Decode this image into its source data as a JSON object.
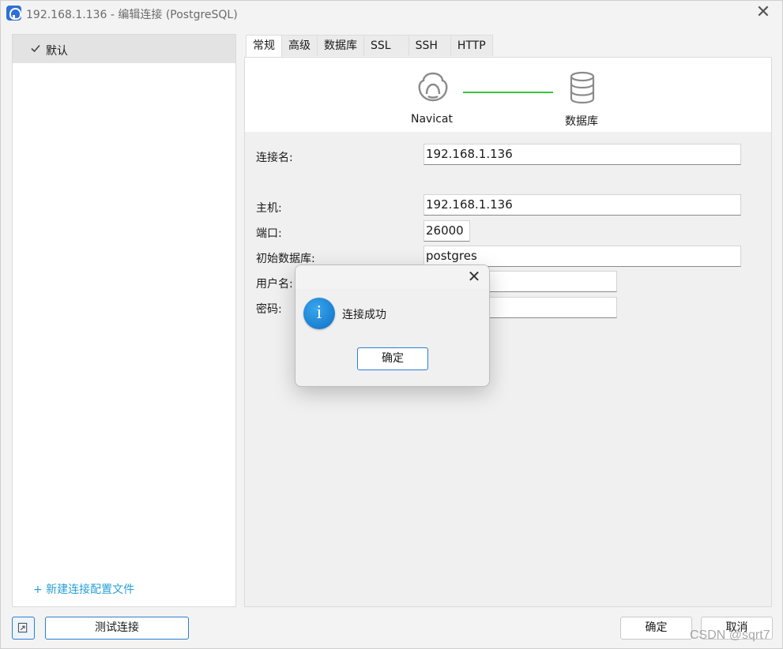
{
  "window": {
    "title": "192.168.1.136 - 编辑连接 (PostgreSQL)",
    "close_glyph": "✕"
  },
  "sidebar": {
    "items": [
      {
        "label": "默认",
        "icon": "check-icon"
      }
    ],
    "new_profile_link": "+ 新建连接配置文件"
  },
  "tabs": [
    {
      "label": "常规",
      "active": true
    },
    {
      "label": "高级",
      "active": false
    },
    {
      "label": "数据库",
      "active": false
    },
    {
      "label": "SSL",
      "active": false
    },
    {
      "label": "SSH",
      "active": false
    },
    {
      "label": "HTTP",
      "active": false
    }
  ],
  "banner": {
    "left_label": "Navicat",
    "right_label": "数据库",
    "link_color": "#3cc23c"
  },
  "form": {
    "connection_name": {
      "label": "连接名:",
      "value": "192.168.1.136"
    },
    "host": {
      "label": "主机:",
      "value": "192.168.1.136"
    },
    "port": {
      "label": "端口:",
      "value": "26000"
    },
    "initial_database": {
      "label": "初始数据库:",
      "value": "postgres"
    },
    "username": {
      "label": "用户名:",
      "value": ""
    },
    "password": {
      "label": "密码:",
      "value": ""
    }
  },
  "footer": {
    "test_connection": "测试连接",
    "ok": "确定",
    "cancel": "取消"
  },
  "dialog": {
    "message": "连接成功",
    "ok_button": "确定",
    "icon": "info-icon",
    "close_glyph": "✕"
  },
  "watermark": "CSDN @sqrt7",
  "colors": {
    "accent": "#2a7fd4",
    "link": "#2a9fd6",
    "selected_item_bg": "#e3e3e3"
  }
}
